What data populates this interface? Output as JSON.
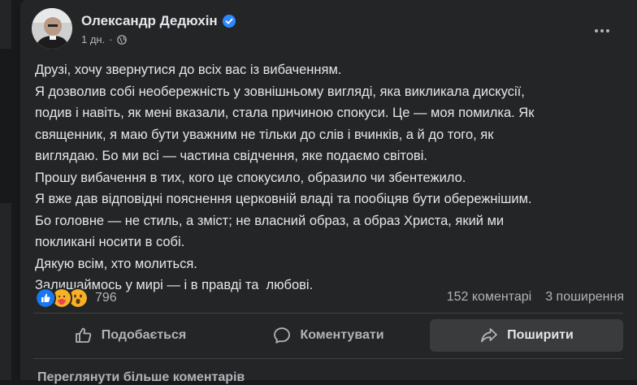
{
  "post": {
    "author": "Олександр Дедюхін",
    "time": "1 дн.",
    "separator": "·",
    "lines": [
      "Друзі, хочу звернутися до всіх вас із вибаченням.",
      "Я дозволив собі необережність у зовнішньому вигляді, яка викликала дискусії,",
      "подив і навіть, як мені вказали, стала причиною спокуси. Це — моя помилка. Як",
      "священник, я маю бути уважним не тільки до слів і вчинків, а й до того, як",
      "виглядаю. Бо ми всі — частина свідчення, яке подаємо світові.",
      "Прошу вибачення в тих, кого це спокусило, образило чи збентежило.",
      "Я вже дав відповідні пояснення церковній владі та пообіцяв бути обережнішим.",
      "Бо головне — не стиль, а зміст; не власний образ, а образ Христа, який ми",
      "покликані носити в собі.",
      "Дякую всім, хто молиться.",
      "Залишаймось у мирі — і в правді та  любові."
    ]
  },
  "stats": {
    "reactions_count": "796",
    "comments": "152 коментарі",
    "shares": "3 поширення"
  },
  "actions": {
    "like": "Подобається",
    "comment": "Коментувати",
    "share": "Поширити"
  },
  "comments_link": "Переглянути більше коментарів",
  "icons": {
    "verified": "verified-badge-icon",
    "privacy": "globe-icon",
    "more": "more-options-icon",
    "like": "thumbs-up-icon",
    "comment": "comment-bubble-icon",
    "share": "share-arrow-icon"
  },
  "colors": {
    "background": "#18191a",
    "card": "#242526",
    "text": "#e4e6eb",
    "muted": "#b0b3b8",
    "verified": "#2d88ff",
    "hover": "#3a3b3c"
  }
}
